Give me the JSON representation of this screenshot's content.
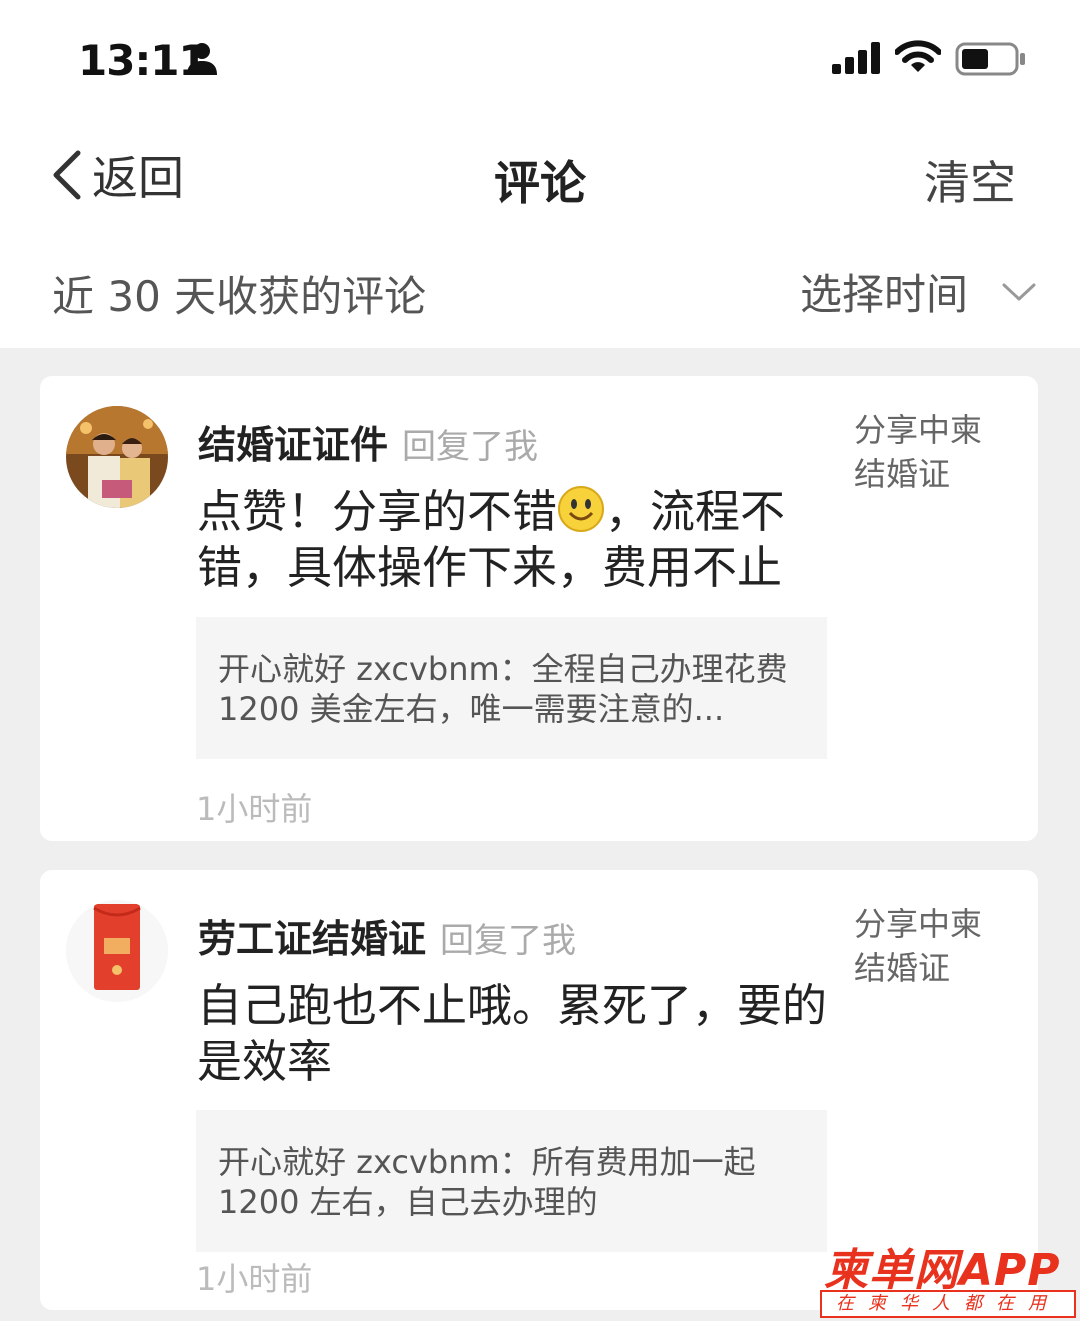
{
  "status_bar": {
    "time": "13:11",
    "icons": [
      "person-icon",
      "signal-icon",
      "wifi-icon",
      "battery-icon"
    ]
  },
  "nav": {
    "back_label": "返回",
    "title": "评论",
    "clear_label": "清空"
  },
  "filter": {
    "label": "近 30 天收获的评论",
    "select_label": "选择时间"
  },
  "comments": [
    {
      "author": "结婚证证件",
      "reply_tag": "回复了我",
      "text_before_emoji": "点赞！分享的不错",
      "text_after_emoji": "，流程不错，具体操作下来，费用不止",
      "quote": "开心就好 zxcvbnm：全程自己办理花费 1200 美金左右，唯一需要注意的...",
      "time": "1小时前",
      "source": "分享中柬结婚证"
    },
    {
      "author": "劳工证结婚证",
      "reply_tag": "回复了我",
      "text": "自己跑也不止哦。累死了，要的是效率",
      "quote": "开心就好 zxcvbnm：所有费用加一起 1200 左右，自己去办理的",
      "time": "1小时前",
      "source": "分享中柬结婚证"
    }
  ],
  "watermark": {
    "brand": "柬单网APP",
    "slogan": "在柬华人都在用"
  },
  "colors": {
    "accent_red": "#e8321e",
    "background": "#efefef"
  }
}
